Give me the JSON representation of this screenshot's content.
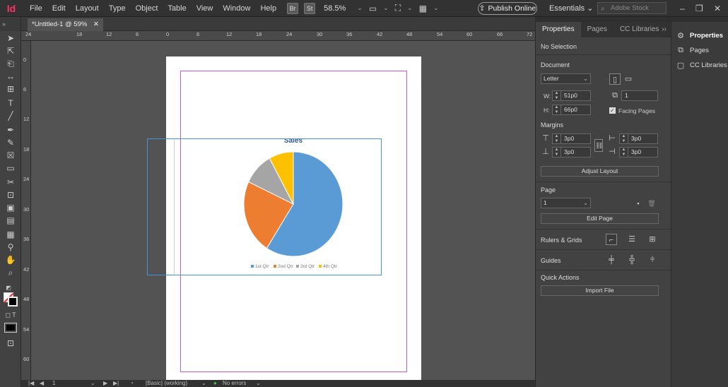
{
  "app": {
    "logo": "Id",
    "menu": [
      "File",
      "Edit",
      "Layout",
      "Type",
      "Object",
      "Table",
      "View",
      "Window",
      "Help"
    ],
    "bridge_badge": "Br",
    "stock_badge": "St",
    "zoom": "58.5%",
    "publish_label": "Publish Online",
    "workspace": "Essentials",
    "search_placeholder": "Adobe Stock",
    "window_controls": [
      "–",
      "❐",
      "✕"
    ]
  },
  "document_tab": {
    "title": "*Untitled-1 @ 59%",
    "close": "✕"
  },
  "rulers": {
    "horizontal": [
      "24",
      "18",
      "12",
      "6",
      "0",
      "6",
      "12",
      "18",
      "24",
      "30",
      "36",
      "42",
      "48",
      "54",
      "60",
      "66",
      "72"
    ],
    "vertical": [
      "0",
      "6",
      "12",
      "18",
      "24",
      "30",
      "36",
      "42",
      "48",
      "54",
      "60"
    ]
  },
  "chart_data": {
    "type": "pie",
    "title": "Sales",
    "categories": [
      "1st Qtr",
      "2nd Qtr",
      "3rd Qtr",
      "4th Qtr"
    ],
    "values": [
      59,
      23,
      10,
      8
    ],
    "colors": [
      "#5b9bd5",
      "#ed7d31",
      "#a5a5a5",
      "#ffc000"
    ],
    "legend": "bottom"
  },
  "statusbar": {
    "page": "1",
    "style": "[Basic] (working)",
    "errors": "No errors"
  },
  "properties": {
    "tabs": [
      "Properties",
      "Pages",
      "CC Libraries"
    ],
    "selection": "No Selection",
    "document_label": "Document",
    "page_size": "Letter",
    "width_label": "W:",
    "width": "51p0",
    "height_label": "H:",
    "height": "66p0",
    "pages_count": "1",
    "facing_pages": "Facing Pages",
    "margins_label": "Margins",
    "margin_top": "3p0",
    "margin_bottom": "3p0",
    "margin_left": "3p0",
    "margin_right": "3p0",
    "adjust_layout": "Adjust Layout",
    "page_label": "Page",
    "page_value": "1",
    "edit_page": "Edit Page",
    "rulers_grids": "Rulers & Grids",
    "guides": "Guides",
    "quick_actions": "Quick Actions",
    "import_file": "Import File"
  },
  "dock": {
    "items": [
      "Properties",
      "Pages",
      "CC Libraries"
    ]
  }
}
